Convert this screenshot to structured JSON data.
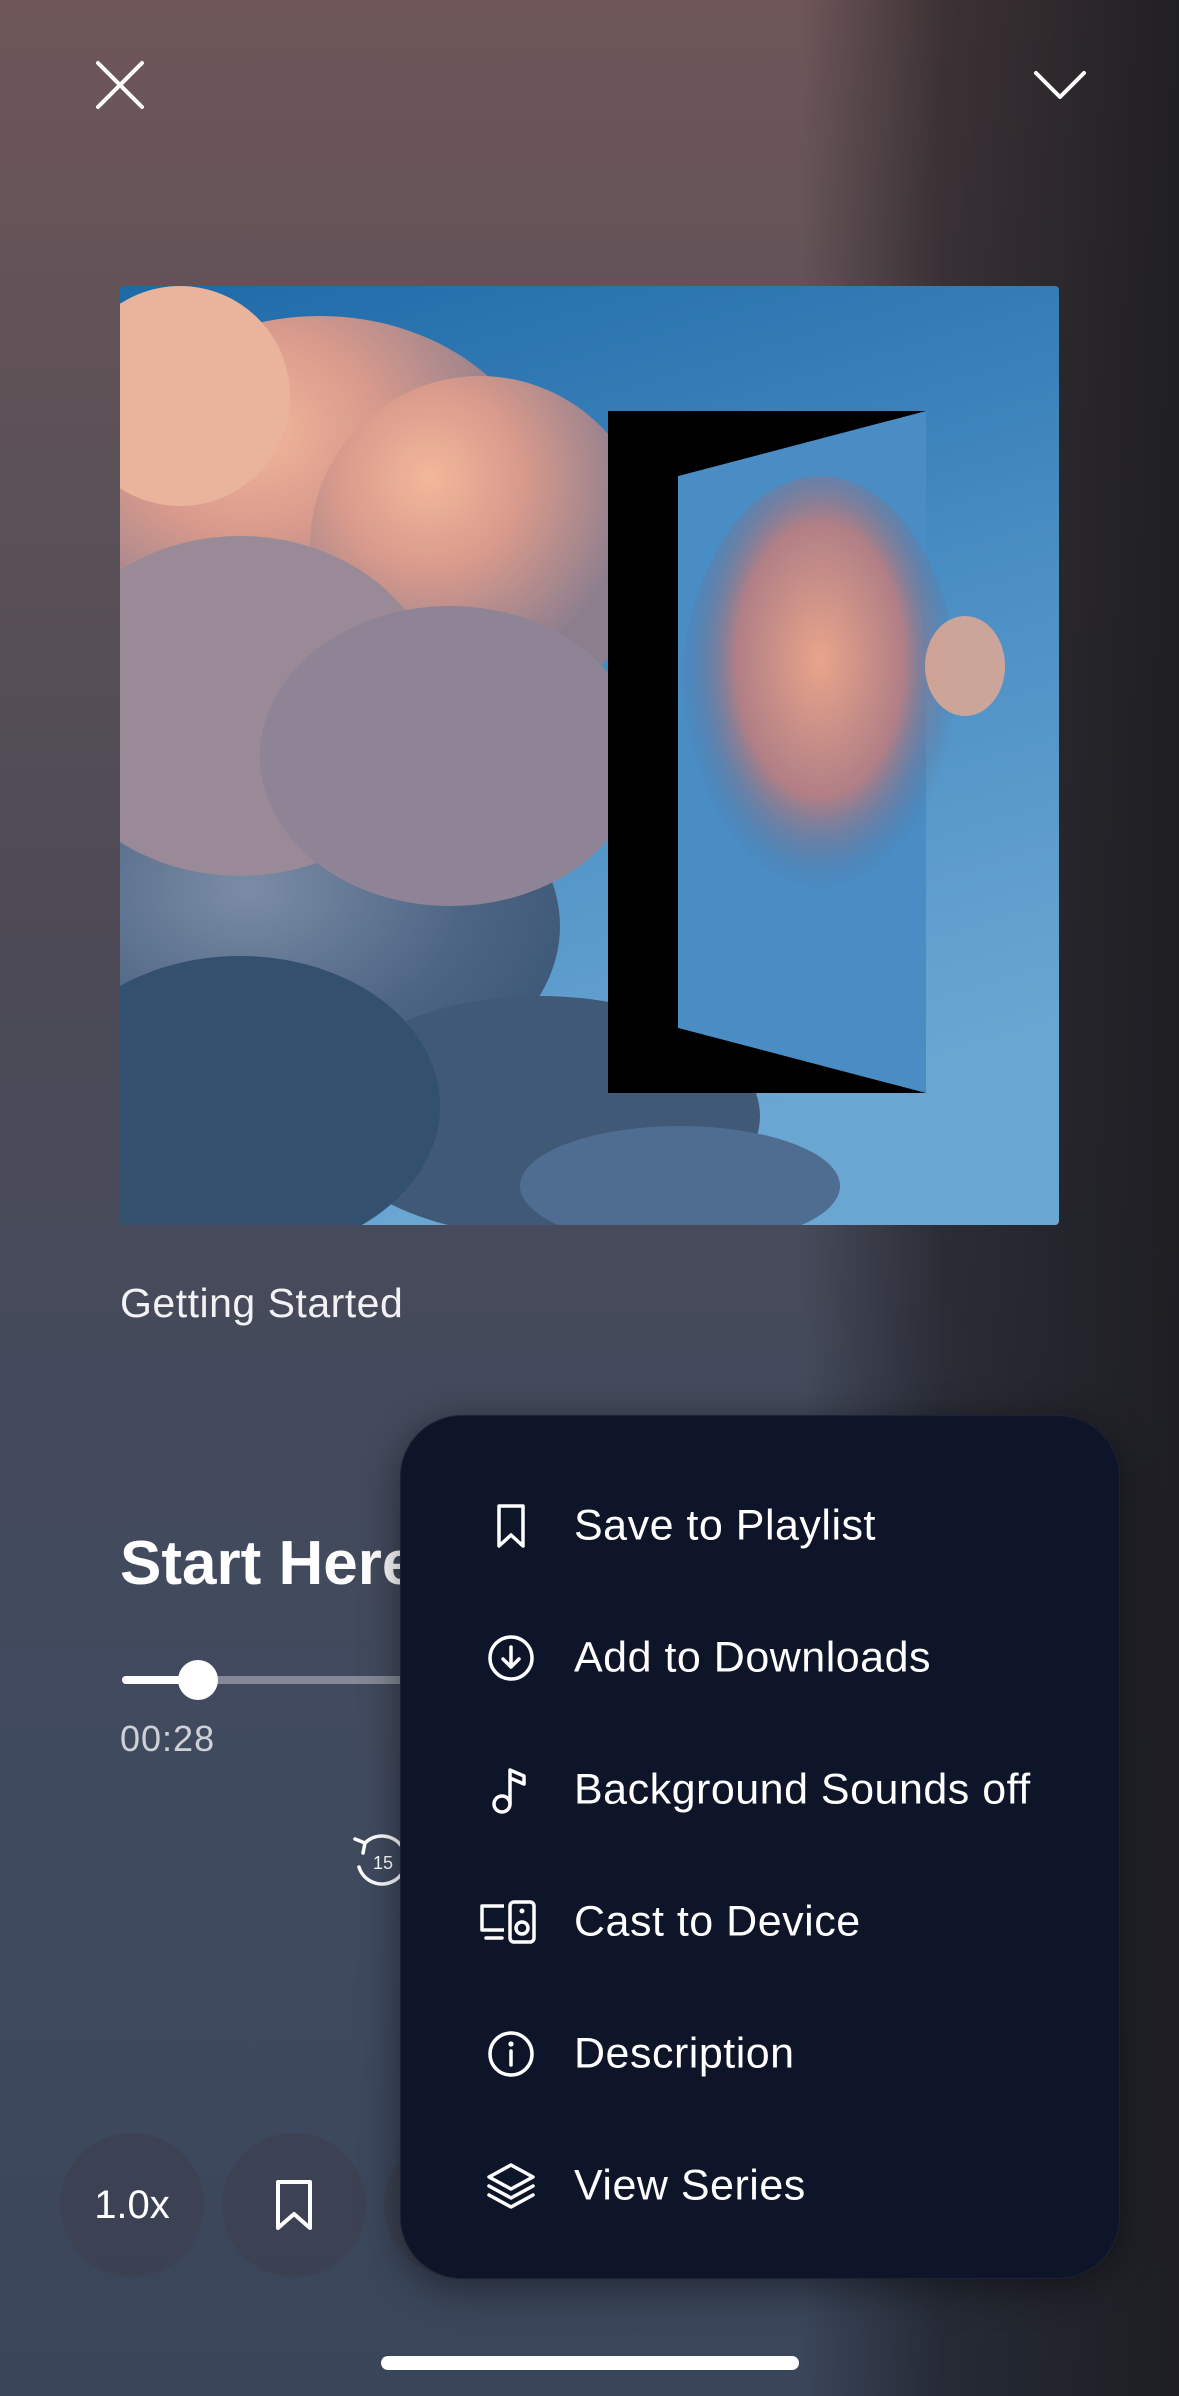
{
  "colors": {
    "menu_background": "#0f1528",
    "text_primary": "#ffffff",
    "progress_track": "rgba(255,255,255,0.35)"
  },
  "header": {
    "close_icon": "close-icon",
    "collapse_icon": "chevron-down-icon"
  },
  "artwork": {
    "description_icon": "artwork-image"
  },
  "series_title": "Getting Started",
  "episode_title": "Start Here",
  "player": {
    "elapsed": "00:28",
    "progress_fraction": 0.09,
    "rewind_seconds": "15"
  },
  "controls": {
    "speed_label": "1.0x"
  },
  "menu": {
    "items": [
      {
        "label": "Save to Playlist",
        "icon": "bookmark-icon"
      },
      {
        "label": "Add to Downloads",
        "icon": "download-icon"
      },
      {
        "label": "Background Sounds off",
        "icon": "music-note-icon"
      },
      {
        "label": "Cast to Device",
        "icon": "cast-device-icon"
      },
      {
        "label": "Description",
        "icon": "info-icon"
      },
      {
        "label": "View Series",
        "icon": "layers-icon"
      }
    ]
  }
}
